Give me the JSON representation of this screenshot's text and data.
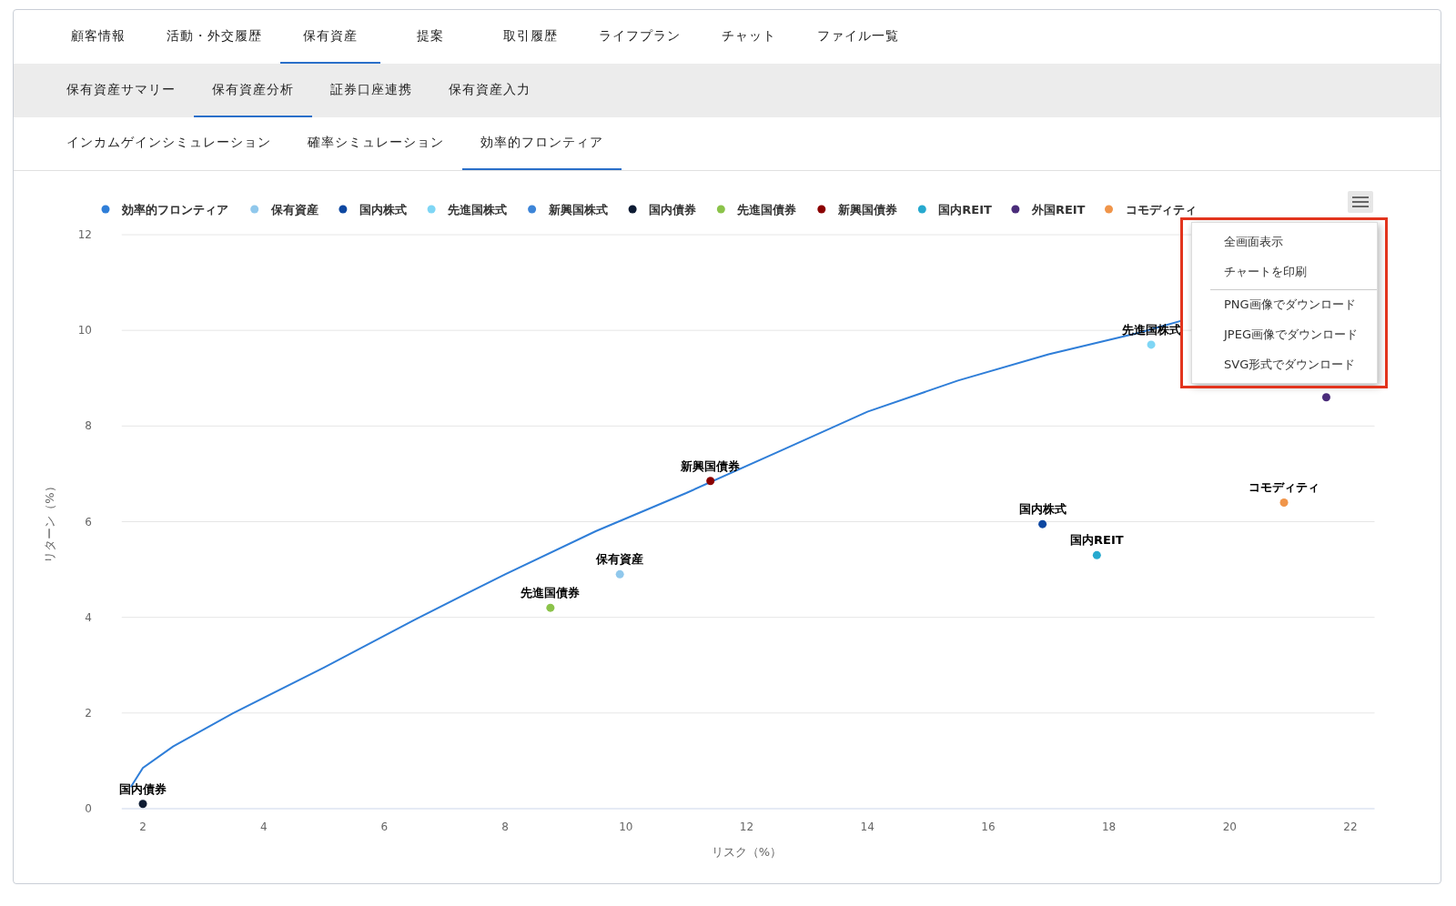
{
  "tabs": [
    {
      "label": "顧客情報",
      "selected": false
    },
    {
      "label": "活動・外交履歴",
      "selected": false
    },
    {
      "label": "保有資産",
      "selected": true
    },
    {
      "label": "提案",
      "selected": false
    },
    {
      "label": "取引履歴",
      "selected": false
    },
    {
      "label": "ライフプラン",
      "selected": false
    },
    {
      "label": "チャット",
      "selected": false
    },
    {
      "label": "ファイル一覧",
      "selected": false
    }
  ],
  "sub_tabs": [
    {
      "label": "保有資産サマリー",
      "selected": false
    },
    {
      "label": "保有資産分析",
      "selected": true
    },
    {
      "label": "証券口座連携",
      "selected": false
    },
    {
      "label": "保有資産入力",
      "selected": false
    }
  ],
  "analysis_tabs": [
    {
      "label": "インカムゲインシミュレーション",
      "selected": false
    },
    {
      "label": "確率シミュレーション",
      "selected": false
    },
    {
      "label": "効率的フロンティア",
      "selected": true
    }
  ],
  "chart": {
    "chart_data": {
      "type": "line",
      "grid": true,
      "legend": true,
      "xlabel": "リスク（%）",
      "ylabel": "リターン（%）",
      "xlim": [
        1.65,
        22.4
      ],
      "ylim": [
        0,
        12
      ],
      "xticks": [
        2,
        4,
        6,
        8,
        10,
        12,
        14,
        16,
        18,
        20,
        22
      ],
      "yticks": [
        0,
        2,
        4,
        6,
        8,
        10,
        12
      ],
      "series": [
        {
          "name": "効率的フロンティア",
          "color": "#2f7ed8",
          "x": [
            1.8,
            2.0,
            2.5,
            3.5,
            5,
            6.5,
            8,
            9.5,
            11,
            12.5,
            14,
            15.5,
            17,
            18.5,
            19.2
          ],
          "values": [
            0.45,
            0.85,
            1.3,
            2.0,
            2.95,
            3.95,
            4.9,
            5.8,
            6.6,
            7.45,
            8.3,
            8.95,
            9.5,
            9.95,
            10.2
          ]
        },
        {
          "name": "保有資産",
          "color": "#90c8ec",
          "marker": true,
          "x": [
            9.9
          ],
          "values": [
            4.9
          ]
        },
        {
          "name": "国内株式",
          "color": "#0d47a1",
          "marker": true,
          "x": [
            16.9
          ],
          "values": [
            5.95
          ]
        },
        {
          "name": "先進国株式",
          "color": "#7fd6f5",
          "marker": true,
          "x": [
            18.7
          ],
          "values": [
            9.7
          ]
        },
        {
          "name": "新興国株式",
          "color": "#3d85d8"
        },
        {
          "name": "国内債券",
          "color": "#0d1b33",
          "marker": true,
          "x": [
            2.0
          ],
          "values": [
            0.1
          ]
        },
        {
          "name": "先進国債券",
          "color": "#8bc34a",
          "marker": true,
          "x": [
            8.75
          ],
          "values": [
            4.2
          ]
        },
        {
          "name": "新興国債券",
          "color": "#8b0000",
          "marker": true,
          "x": [
            11.4
          ],
          "values": [
            6.85
          ]
        },
        {
          "name": "国内REIT",
          "color": "#26a9cf",
          "marker": true,
          "x": [
            17.8
          ],
          "values": [
            5.3
          ]
        },
        {
          "name": "外国REIT",
          "color": "#4a2c7a",
          "marker": true,
          "x": [
            21.6
          ],
          "values": [
            8.6
          ]
        },
        {
          "name": "コモディティ",
          "color": "#f0954a",
          "marker": true,
          "x": [
            20.9
          ],
          "values": [
            6.4
          ]
        }
      ],
      "annotations": [
        {
          "text": "保有資産",
          "x": 9.9,
          "y": 4.9
        },
        {
          "text": "国内株式",
          "x": 16.9,
          "y": 5.95
        },
        {
          "text": "先進国株式",
          "x": 18.7,
          "y": 9.7
        },
        {
          "text": "国内債券",
          "x": 2.0,
          "y": 0.1
        },
        {
          "text": "先進国債券",
          "x": 8.75,
          "y": 4.2
        },
        {
          "text": "新興国債券",
          "x": 11.4,
          "y": 6.85
        },
        {
          "text": "国内REIT",
          "x": 17.8,
          "y": 5.3
        },
        {
          "text": "コモディティ",
          "x": 20.9,
          "y": 6.4
        }
      ]
    },
    "menu": {
      "highlight": true,
      "items": [
        {
          "label": "全画面表示",
          "divider_before": false
        },
        {
          "label": "チャートを印刷",
          "divider_before": false
        },
        {
          "label": "PNG画像でダウンロード",
          "divider_before": true
        },
        {
          "label": "JPEG画像でダウンロード",
          "divider_before": false
        },
        {
          "label": "SVG形式でダウンロード",
          "divider_before": false
        }
      ]
    }
  }
}
